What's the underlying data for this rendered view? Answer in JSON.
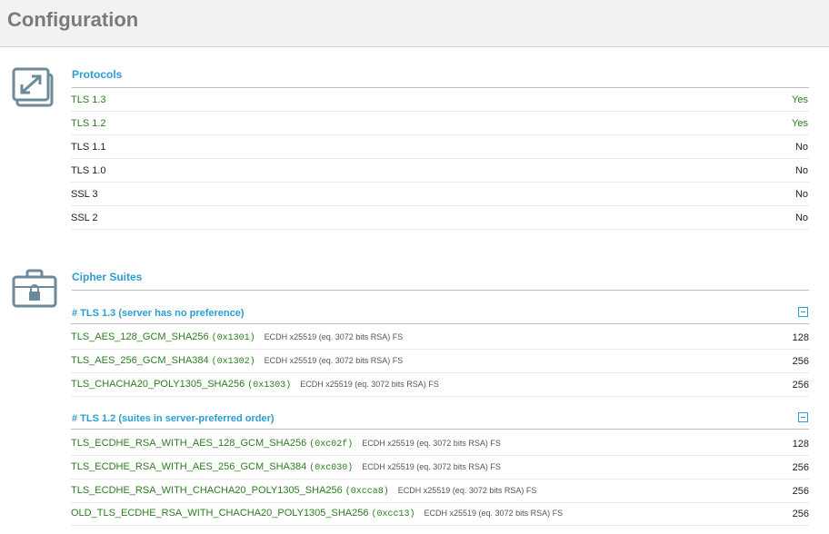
{
  "page": {
    "title": "Configuration"
  },
  "protocols": {
    "title": "Protocols",
    "icon": "resize-arrows-icon",
    "rows": [
      {
        "name": "TLS 1.3",
        "value": "Yes",
        "enabled": true
      },
      {
        "name": "TLS 1.2",
        "value": "Yes",
        "enabled": true
      },
      {
        "name": "TLS 1.1",
        "value": "No",
        "enabled": false
      },
      {
        "name": "TLS 1.0",
        "value": "No",
        "enabled": false
      },
      {
        "name": "SSL 3",
        "value": "No",
        "enabled": false
      },
      {
        "name": "SSL 2",
        "value": "No",
        "enabled": false
      }
    ]
  },
  "cipher_suites": {
    "title": "Cipher Suites",
    "icon": "toolbox-lock-icon",
    "groups": [
      {
        "heading": "# TLS 1.3 (server has no preference)",
        "suites": [
          {
            "name": "TLS_AES_128_GCM_SHA256",
            "code": "(0x1301)",
            "info": "ECDH x25519 (eq. 3072 bits RSA)   FS",
            "bits": "128"
          },
          {
            "name": "TLS_AES_256_GCM_SHA384",
            "code": "(0x1302)",
            "info": "ECDH x25519 (eq. 3072 bits RSA)   FS",
            "bits": "256"
          },
          {
            "name": "TLS_CHACHA20_POLY1305_SHA256",
            "code": "(0x1303)",
            "info": "ECDH x25519 (eq. 3072 bits RSA)   FS",
            "bits": "256"
          }
        ]
      },
      {
        "heading": "# TLS 1.2 (suites in server-preferred order)",
        "suites": [
          {
            "name": "TLS_ECDHE_RSA_WITH_AES_128_GCM_SHA256",
            "code": "(0xc02f)",
            "info": "ECDH x25519 (eq. 3072 bits RSA)   FS",
            "bits": "128"
          },
          {
            "name": "TLS_ECDHE_RSA_WITH_AES_256_GCM_SHA384",
            "code": "(0xc030)",
            "info": "ECDH x25519 (eq. 3072 bits RSA)   FS",
            "bits": "256"
          },
          {
            "name": "TLS_ECDHE_RSA_WITH_CHACHA20_POLY1305_SHA256",
            "code": "(0xcca8)",
            "info": "ECDH x25519 (eq. 3072 bits RSA)   FS",
            "bits": "256"
          },
          {
            "name": "OLD_TLS_ECDHE_RSA_WITH_CHACHA20_POLY1305_SHA256",
            "code": "(0xcc13)",
            "info": "ECDH x25519 (eq. 3072 bits RSA)   FS",
            "bits": "256"
          }
        ]
      }
    ]
  },
  "colors": {
    "accent": "#2c9dd2",
    "enabled": "#2a7e1f",
    "icon": "#6b8a9a"
  }
}
